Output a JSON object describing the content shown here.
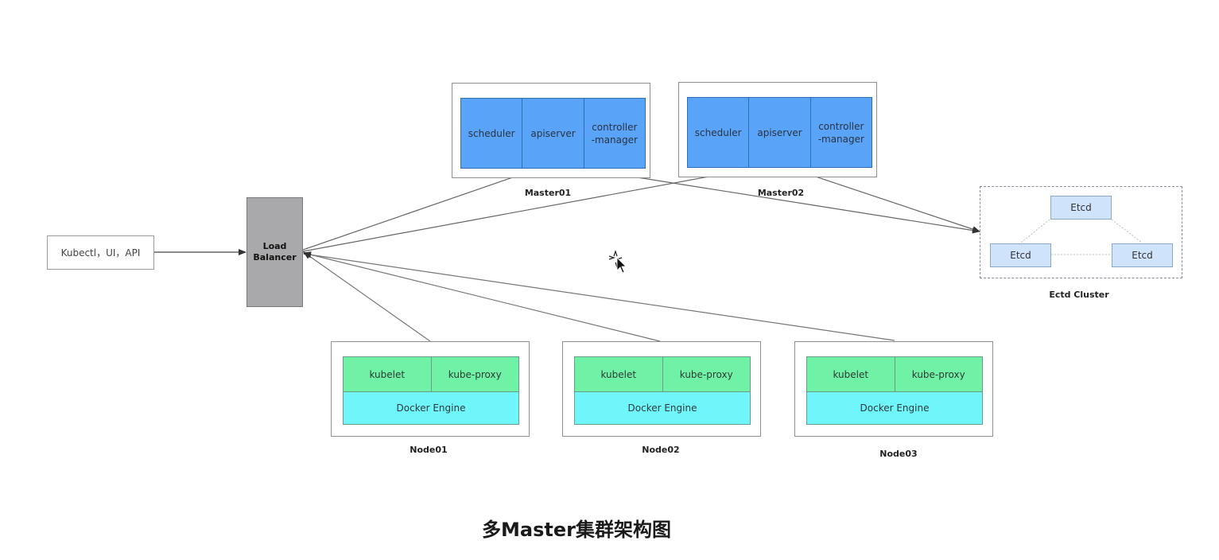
{
  "client": {
    "label": "Kubectl，UI，API"
  },
  "load_balancer": {
    "label": "Load\nBalancer"
  },
  "masters": [
    {
      "name": "Master01",
      "components": [
        "scheduler",
        "apiserver",
        "controller\n-manager"
      ]
    },
    {
      "name": "Master02",
      "components": [
        "scheduler",
        "apiserver",
        "controller\n-manager"
      ]
    }
  ],
  "nodes": [
    {
      "name": "Node01",
      "kubelet": "kubelet",
      "kube_proxy": "kube-proxy",
      "engine": "Docker Engine"
    },
    {
      "name": "Node02",
      "kubelet": "kubelet",
      "kube_proxy": "kube-proxy",
      "engine": "Docker Engine"
    },
    {
      "name": "Node03",
      "kubelet": "kubelet",
      "kube_proxy": "kube-proxy",
      "engine": "Docker Engine"
    }
  ],
  "etcd_cluster": {
    "name": "Ectd Cluster",
    "members": [
      "Etcd",
      "Etcd",
      "Etcd"
    ]
  },
  "title": "多Master集群架构图",
  "colors": {
    "master_component": "#59a4f8",
    "node_agent": "#6ff2a6",
    "docker_engine": "#6ff6fb",
    "etcd": "#cfe4fb",
    "load_balancer": "#a9a9ab"
  },
  "icons": {
    "cursor": "move-cursor-icon"
  }
}
